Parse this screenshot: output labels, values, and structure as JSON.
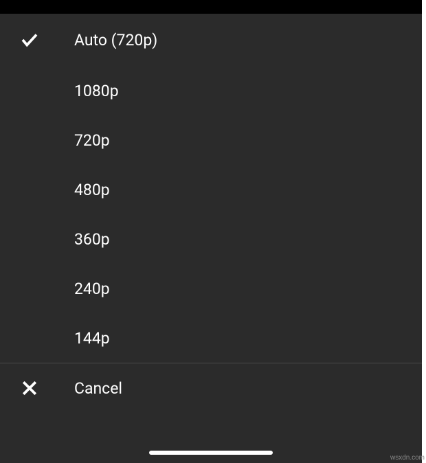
{
  "quality_menu": {
    "options": [
      {
        "label": "Auto (720p)",
        "selected": true
      },
      {
        "label": "1080p",
        "selected": false
      },
      {
        "label": "720p",
        "selected": false
      },
      {
        "label": "480p",
        "selected": false
      },
      {
        "label": "360p",
        "selected": false
      },
      {
        "label": "240p",
        "selected": false
      },
      {
        "label": "144p",
        "selected": false
      }
    ],
    "cancel_label": "Cancel"
  },
  "watermark": "wsxdn.com"
}
